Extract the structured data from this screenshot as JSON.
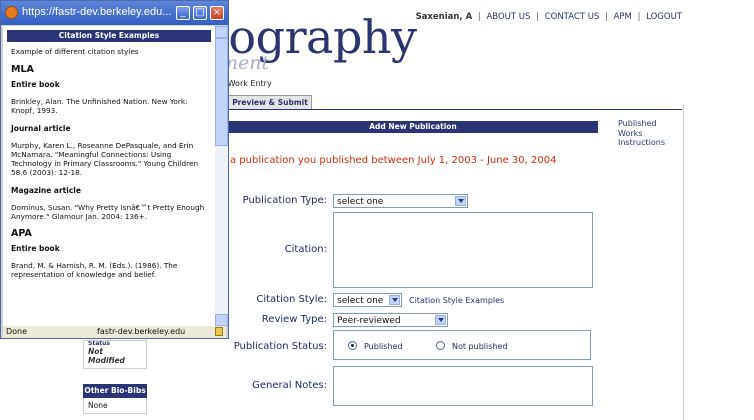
{
  "header": {
    "logo_main": "liography",
    "logo_sub": "ment",
    "user": "Saxenian, A",
    "nav": [
      "ABOUT US",
      "CONTACT US",
      "APM",
      "LOGOUT"
    ]
  },
  "breadcrumb": "hed Work Entry",
  "tab": "Preview & Submit",
  "form": {
    "header": "Add New Publication",
    "intro": "a publication you published between July 1, 2003 - June 30, 2004",
    "labels": {
      "publication_type": "Publication Type:",
      "citation": "Citation:",
      "citation_style": "Citation Style:",
      "review_type": "Review Type:",
      "publication_status": "Publication Status:",
      "general_notes": "General Notes:"
    },
    "publication_type_value": "select one",
    "citation_style_value": "select one",
    "citation_style_link": "Citation Style Examples",
    "review_type_value": "Peer-reviewed",
    "status_options": [
      "Published",
      "Not published"
    ],
    "status_selected": "Published"
  },
  "right_sidebar": {
    "link": "Published Works Instructions"
  },
  "left_sidebar": {
    "box1_partial": "Status",
    "box1_value": "Not Modified",
    "box2_header": "Other Bio-Bibs",
    "box2_value": "None"
  },
  "popup": {
    "title": "https://fastr-dev.berkeley.edu...",
    "header": "Citation Style Examples",
    "intro": "Example of different citation styles",
    "sections": [
      {
        "style": "MLA",
        "items": [
          {
            "type": "Entire book",
            "text": "Brinkley, Alan. The Unfinished Nation. New York: Knopf, 1993."
          },
          {
            "type": "Journal article",
            "text": "Murphy, Karen L., Roseanne DePasquale, and Erin McNamara. \"Meaningful Connections: Using Technology in Primary Classrooms.\" Young Children 58.6 (2003): 12-18."
          },
          {
            "type": "Magazine article",
            "text": "Dominus, Susan. \"Why Pretty Isnâ€™t Pretty Enough Anymore.\" Glamour Jan. 2004: 136+."
          }
        ]
      },
      {
        "style": "APA",
        "items": [
          {
            "type": "Entire book",
            "text": "Brand, M. & Harnish, R. M. (Eds.). (1986). The representation of knowledge and belief."
          }
        ]
      }
    ],
    "status_left": "Done",
    "status_right": "fastr-dev.berkeley.edu"
  }
}
